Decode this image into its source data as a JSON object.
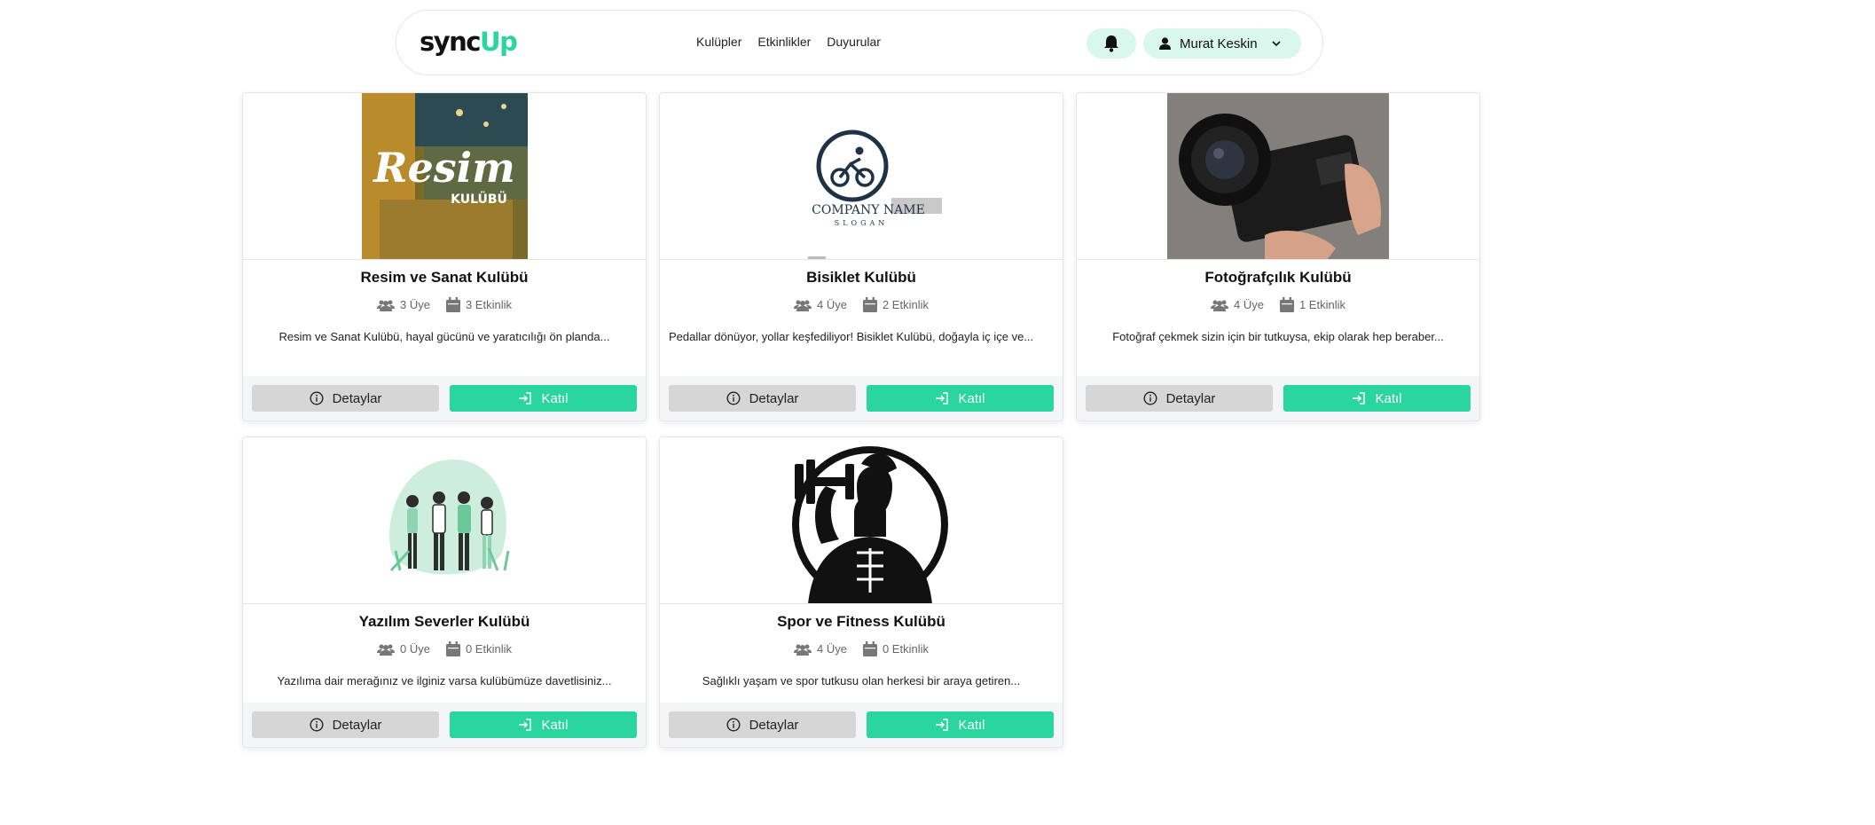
{
  "brand": {
    "logo_part1": "sync",
    "logo_part2": "Up"
  },
  "nav": {
    "links": [
      "Kulüpler",
      "Etkinlikler",
      "Duyurular"
    ]
  },
  "user": {
    "name": "Murat Keskin"
  },
  "buttons": {
    "details": "Detaylar",
    "join": "Katıl"
  },
  "colors": {
    "accent": "#2ad59e",
    "accent_light": "#d9f7ec",
    "button_gray": "#d6d6d6"
  },
  "clubs": [
    {
      "title": "Resim ve Sanat Kulübü",
      "members": "3 Üye",
      "events": "3 Etkinlik",
      "desc": "Resim ve Sanat Kulübü, hayal gücünü ve yaratıcılığı ön planda...",
      "image_text1": "Resim",
      "image_text2": "KULÜBÜ"
    },
    {
      "title": "Bisiklet Kulübü",
      "members": "4 Üye",
      "events": "2 Etkinlik",
      "desc": "Pedallar dönüyor, yollar keşfediliyor! Bisiklet Kulübü, doğayla iç içe ve...",
      "image_text1": "COMPANY NAME",
      "image_text2": "SLOGAN"
    },
    {
      "title": "Fotoğrafçılık Kulübü",
      "members": "4 Üye",
      "events": "1 Etkinlik",
      "desc": "Fotoğraf çekmek sizin için bir tutkuysa, ekip olarak hep beraber..."
    },
    {
      "title": "Yazılım Severler Kulübü",
      "members": "0 Üye",
      "events": "0 Etkinlik",
      "desc": "Yazılıma dair merağınız ve ilginiz varsa kulübümüze davetlisiniz..."
    },
    {
      "title": "Spor ve Fitness Kulübü",
      "members": "4 Üye",
      "events": "0 Etkinlik",
      "desc": "Sağlıklı yaşam ve spor tutkusu olan herkesi bir araya getiren..."
    }
  ]
}
